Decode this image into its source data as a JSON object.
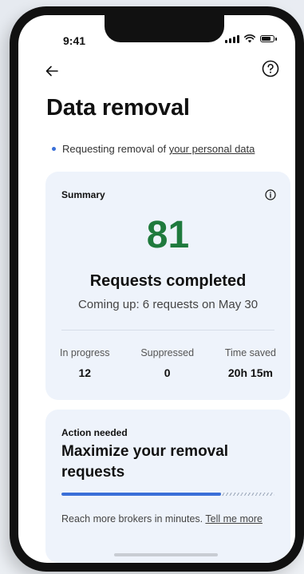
{
  "status_bar": {
    "time": "9:41"
  },
  "header": {
    "back_icon": "arrow-left-icon",
    "help_icon": "question-circle-icon",
    "title": "Data removal"
  },
  "notice": {
    "prefix": "Requesting removal of ",
    "link": "your personal data"
  },
  "summary": {
    "label": "Summary",
    "info_icon": "info-icon",
    "count": "81",
    "count_label": "Requests completed",
    "coming_up": "Coming up: 6 requests on May 30",
    "stats": [
      {
        "label": "In progress",
        "value": "12"
      },
      {
        "label": "Suppressed",
        "value": "0"
      },
      {
        "label": "Time saved",
        "value": "20h 15m"
      }
    ]
  },
  "action": {
    "label": "Action needed",
    "title": "Maximize your removal requests",
    "progress": 0.75,
    "desc_prefix": "Reach more brokers in minutes. ",
    "desc_link": "Tell me more"
  },
  "colors": {
    "accent_green": "#1f7a3d",
    "accent_blue": "#3a6fd8",
    "card_bg": "#eef3fb"
  }
}
